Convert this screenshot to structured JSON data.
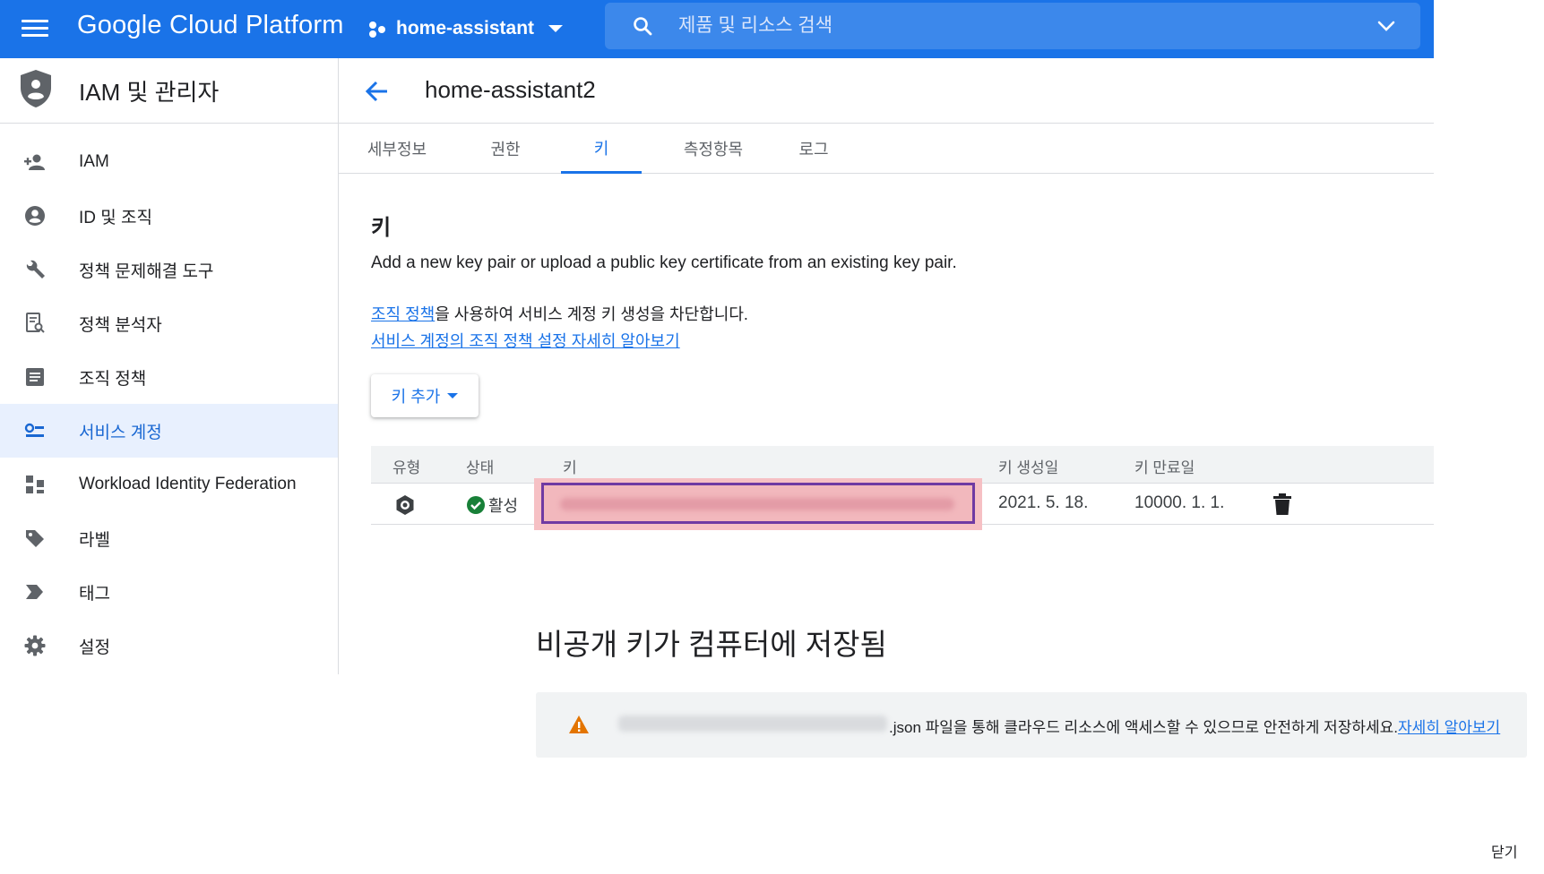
{
  "topbar": {
    "brand": "Google Cloud Platform",
    "project": "home-assistant",
    "search_placeholder": "제품 및 리소스 검색"
  },
  "sidebar": {
    "title": "IAM 및 관리자",
    "items": [
      {
        "label": "IAM",
        "icon": "person-add-icon"
      },
      {
        "label": "ID 및 조직",
        "icon": "account-circle-icon"
      },
      {
        "label": "정책 문제해결 도구",
        "icon": "wrench-icon"
      },
      {
        "label": "정책 분석자",
        "icon": "document-search-icon"
      },
      {
        "label": "조직 정책",
        "icon": "list-alt-icon"
      },
      {
        "label": "서비스 계정",
        "icon": "service-account-icon",
        "active": true
      },
      {
        "label": "Workload Identity Federation",
        "icon": "workload-identity-icon"
      },
      {
        "label": "라벨",
        "icon": "label-icon"
      },
      {
        "label": "태그",
        "icon": "tag-chevron-icon"
      },
      {
        "label": "설정",
        "icon": "gear-icon"
      }
    ]
  },
  "main": {
    "title": "home-assistant2",
    "tabs": [
      "세부정보",
      "권한",
      "키",
      "측정항목",
      "로그"
    ],
    "active_tab": "키",
    "section_title": "키",
    "description": "Add a new key pair or upload a public key certificate from an existing key pair.",
    "policy_link": "조직 정책",
    "policy_text": "을 사용하여 서비스 계정 키 생성을 차단합니다.",
    "learn_more": "서비스 계정의 조직 정책 설정 자세히 알아보기",
    "add_key_label": "키 추가",
    "table": {
      "headers": [
        "유형",
        "상태",
        "키",
        "키 생성일",
        "키 만료일"
      ],
      "rows": [
        {
          "status": "활성",
          "created": "2021. 5. 18.",
          "expires": "10000. 1. 1."
        }
      ]
    }
  },
  "dialog": {
    "title": "비공개 키가 컴퓨터에 저장됨",
    "warning_text": ".json 파일을 통해 클라우드 리소스에 액세스할 수 있으므로 안전하게 저장하세요.",
    "warning_link": "자세히 알아보기",
    "close_label": "닫기"
  },
  "colors": {
    "primary": "#1a73e8",
    "active_nav_bg": "#e8f0fe",
    "highlight": "#f6c0c4",
    "highlight_border": "#6f3aa3",
    "status_green": "#188038",
    "warning_orange": "#e37400"
  }
}
